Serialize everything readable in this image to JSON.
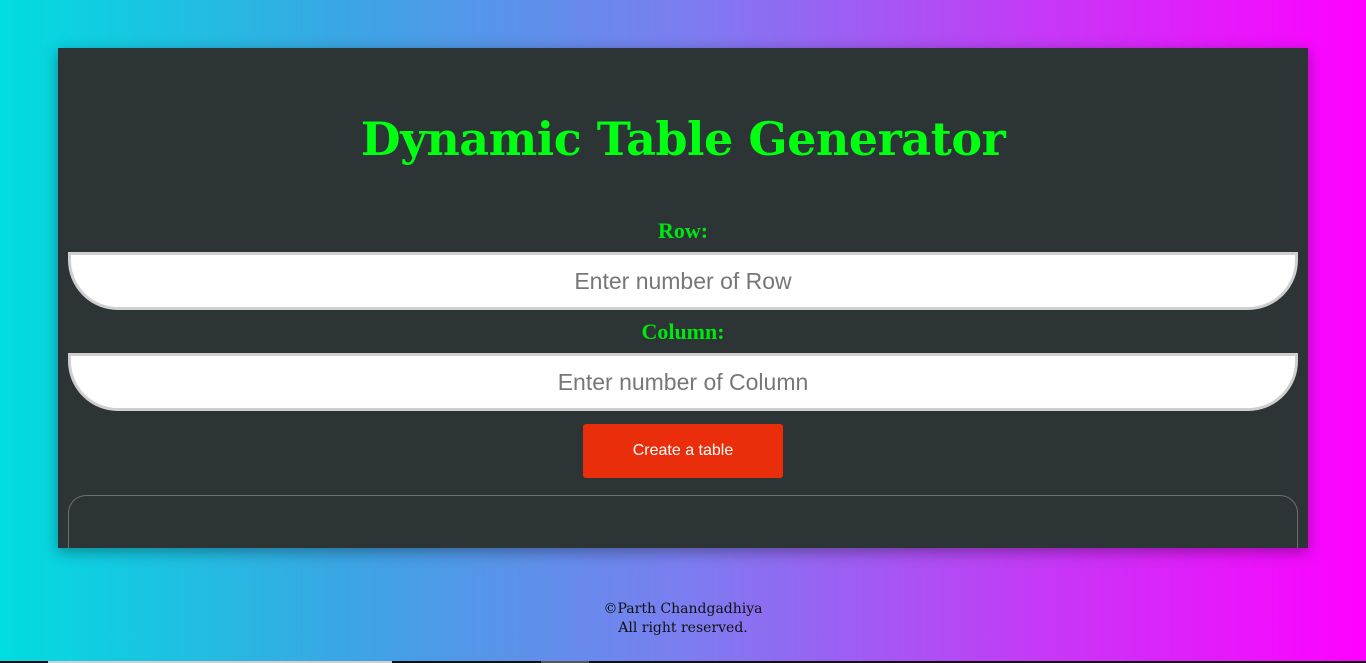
{
  "app": {
    "title": "Dynamic Table Generator"
  },
  "form": {
    "row_label": "Row:",
    "row_placeholder": "Enter number of Row",
    "row_value": "",
    "column_label": "Column:",
    "column_placeholder": "Enter number of Column",
    "column_value": "",
    "submit_label": "Create a table"
  },
  "footer": {
    "copyright": "©Parth Chandgadhiya",
    "rights": "All right reserved."
  },
  "colors": {
    "title": "#00ff11",
    "card_background": "#2d3436",
    "button": "#ea2e0b",
    "gradient_start": "#00dde0",
    "gradient_end": "#ff00ff"
  }
}
